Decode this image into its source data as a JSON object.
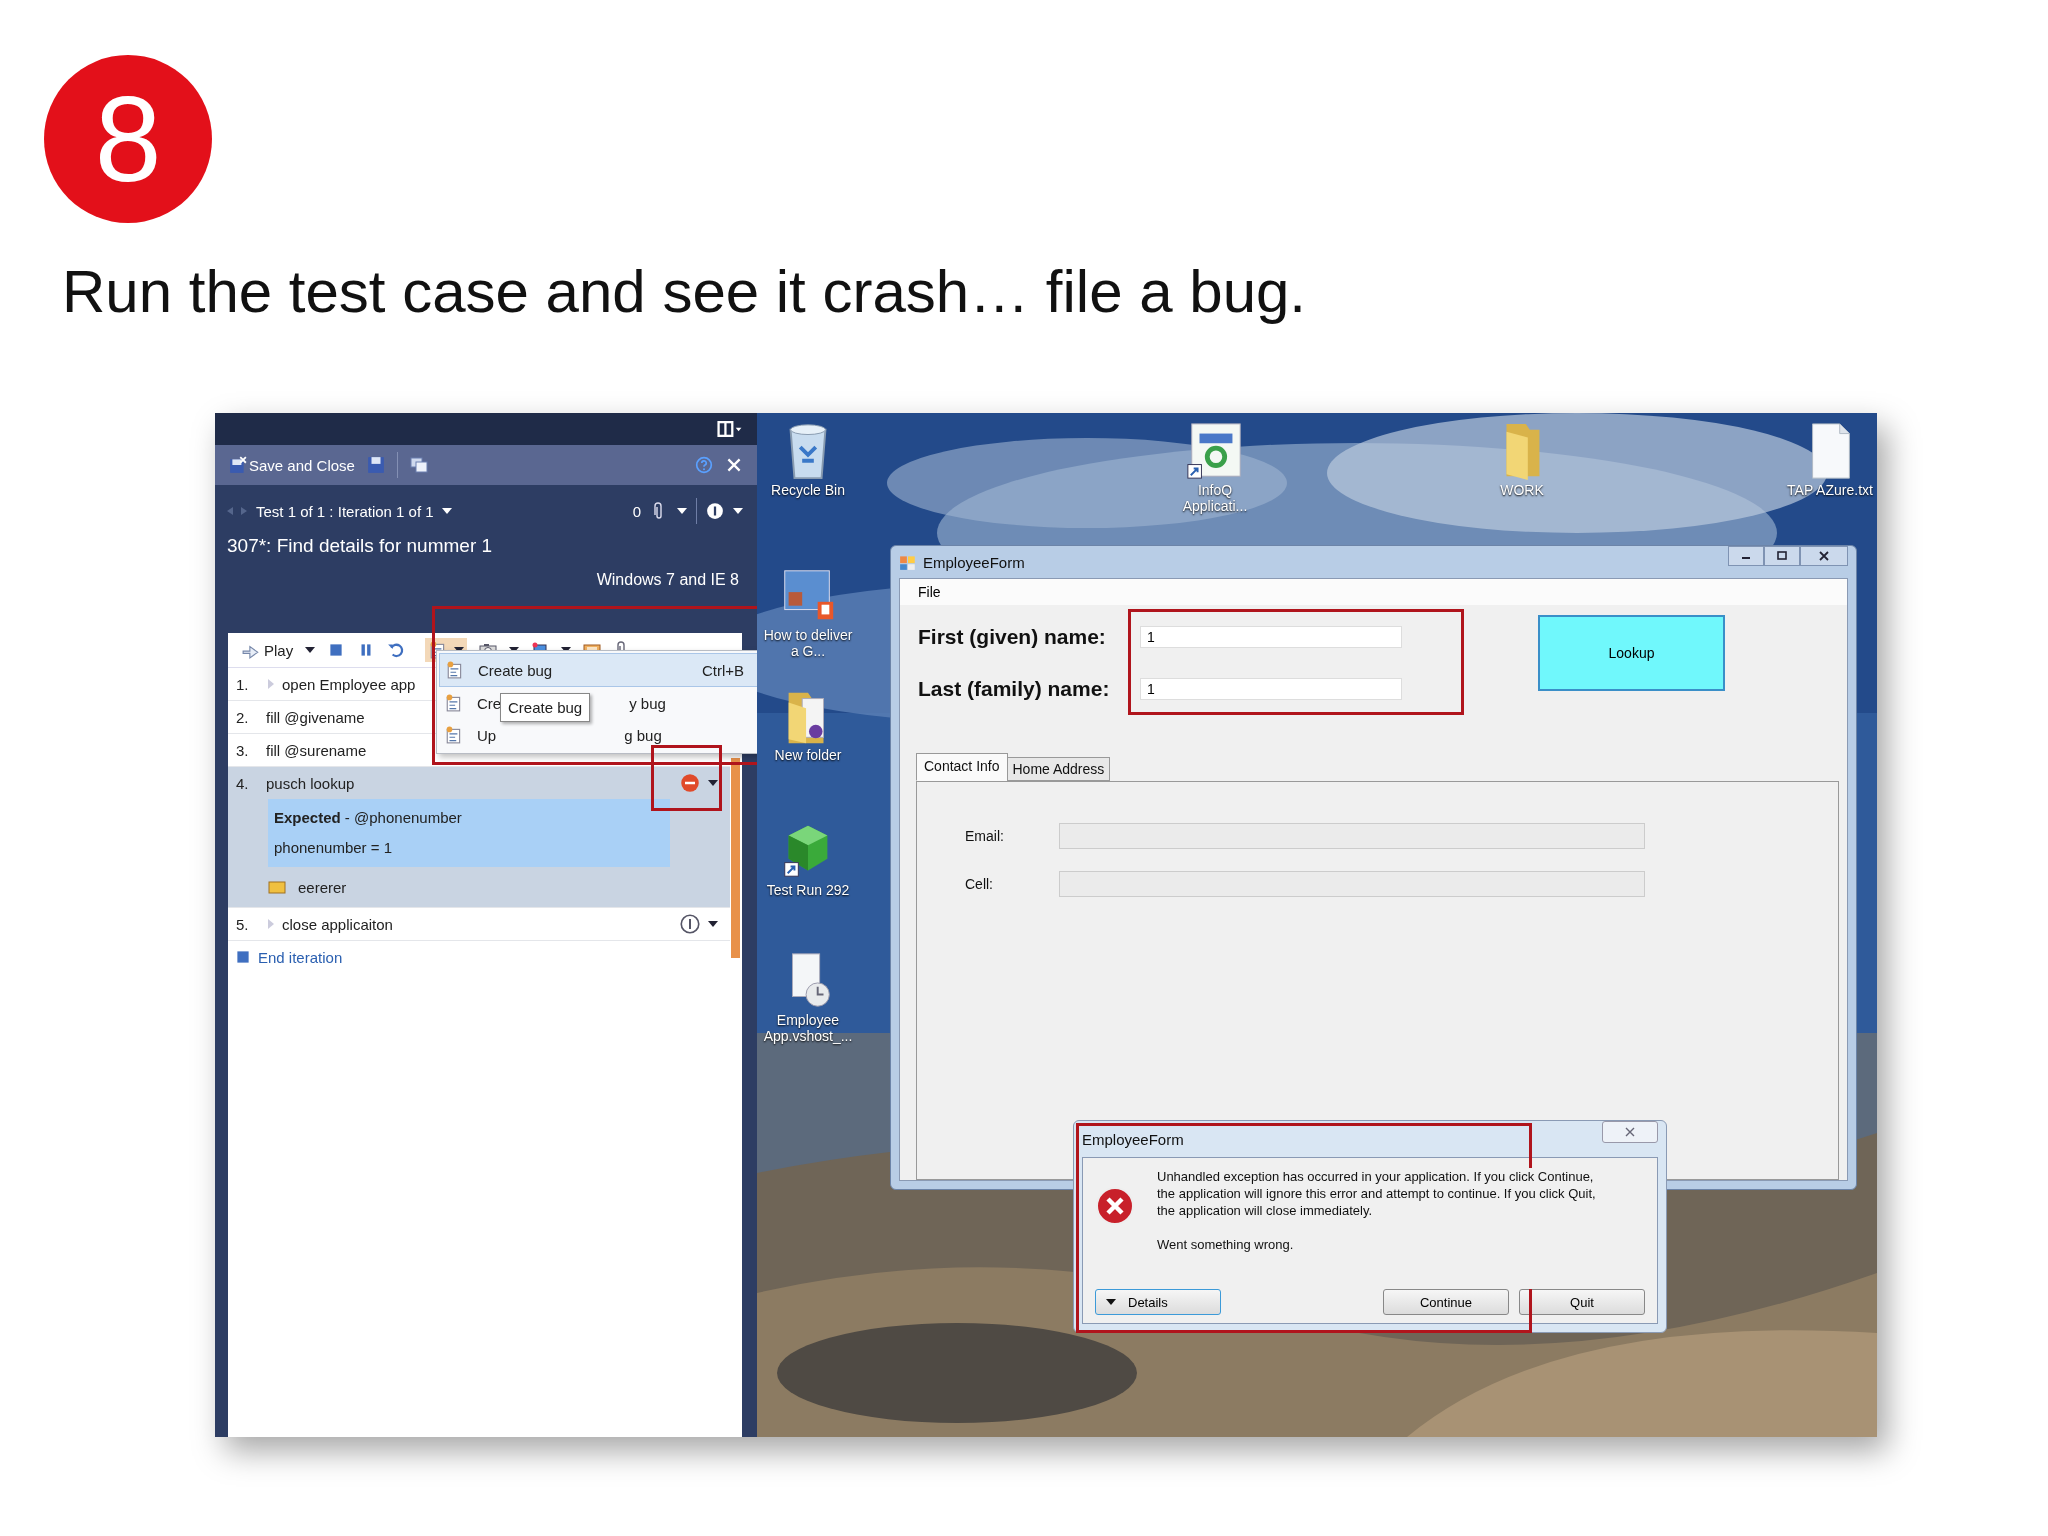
{
  "slide": {
    "step_number": "8",
    "title": "Run the test case and see it crash… file a bug."
  },
  "test_runner": {
    "save_close": "Save and Close",
    "iteration": "Test 1 of 1 : Iteration 1 of 1",
    "attachment_count": "0",
    "test_title": "307*: Find details for nummer 1",
    "configuration": "Windows 7 and IE 8",
    "play": "Play",
    "steps": [
      {
        "number": "1.",
        "text": "open Employee app",
        "selected": false,
        "failed": false,
        "info": false,
        "expandable": true
      },
      {
        "number": "2.",
        "text": "fill @givename",
        "selected": false,
        "failed": false,
        "info": false,
        "expandable": false
      },
      {
        "number": "3.",
        "text": "fill @surename",
        "selected": false,
        "failed": false,
        "info": false,
        "expandable": false
      },
      {
        "number": "4.",
        "text": "pusch lookup",
        "selected": true,
        "failed": true,
        "info": false,
        "expandable": false,
        "expected": "**Expected** - @phonenumber",
        "expected_value": "phonenumber = 1",
        "attachment": "eererer"
      },
      {
        "number": "5.",
        "text": "close applicaiton",
        "selected": false,
        "failed": false,
        "info": true,
        "expandable": true
      }
    ],
    "end_iteration": "End iteration",
    "bug_menu": [
      {
        "kind": "whole",
        "label": "Create bug",
        "shortcut": "Ctrl+B",
        "selected": true
      },
      {
        "kind": "covered",
        "label_start": "Cre",
        "label_end": "y bug",
        "selected": false
      },
      {
        "kind": "covered",
        "label_start": "Up",
        "label_end": "g bug",
        "selected": false
      }
    ],
    "tooltip": "Create bug"
  },
  "desktop": {
    "icons": [
      {
        "kind": "recycle",
        "label": "Recycle Bin"
      },
      {
        "kind": "app-shortcut",
        "label": "InfoQ Applicati..."
      },
      {
        "kind": "folder",
        "label": "WORK"
      },
      {
        "kind": "text-file",
        "label": "TAP AZure.txt"
      },
      {
        "kind": "presentation",
        "label": "How to deliver a G..."
      },
      {
        "kind": "document-folder",
        "label": "New folder"
      },
      {
        "kind": "package-shortcut",
        "label": "Test Run 292"
      },
      {
        "kind": "document-clock",
        "label": "Employee App.vshost_..."
      }
    ]
  },
  "employee_form": {
    "title": "EmployeeForm",
    "menu": [
      "File"
    ],
    "name_fields": [
      {
        "label": "First (given) name:",
        "value": "1"
      },
      {
        "label": "Last (family) name:",
        "value": "1"
      }
    ],
    "lookup_button": "Lookup",
    "tabs": [
      {
        "label": "Contact Info",
        "selected": true
      },
      {
        "label": "Home Address",
        "selected": false
      }
    ],
    "contact_fields": [
      {
        "label": "Email:"
      },
      {
        "label": "Cell:"
      }
    ]
  },
  "error_dialog": {
    "title": "EmployeeForm",
    "message": "Unhandled exception has occurred in your application. If you click Continue, the application will ignore this error and attempt to continue. If you click Quit, the application will close immediately.",
    "detail": "Went something wrong.",
    "buttons": [
      {
        "label": "Details",
        "kind": "expander"
      },
      {
        "label": "Continue",
        "kind": "plain"
      },
      {
        "label": "Quit",
        "kind": "plain"
      }
    ]
  }
}
